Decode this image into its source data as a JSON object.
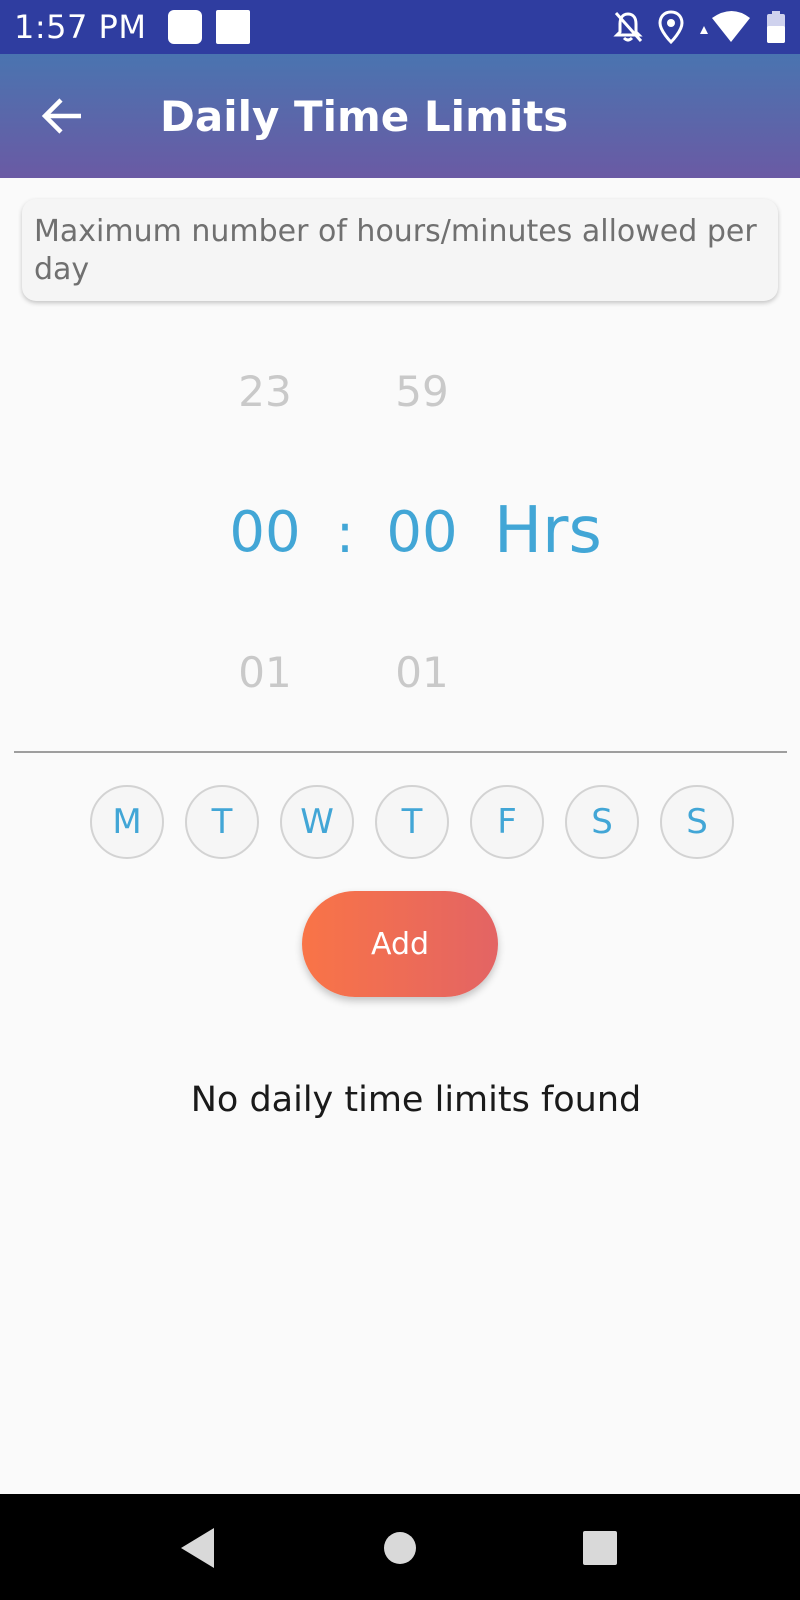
{
  "status_bar": {
    "time": "1:57 PM",
    "icons": [
      "app-notification-icon",
      "app-notification-icon",
      "notifications-off-icon",
      "location-icon",
      "wifi-icon",
      "battery-icon"
    ]
  },
  "app_bar": {
    "title": "Daily Time Limits",
    "back_icon": "arrow-left-icon"
  },
  "description": "Maximum number of hours/minutes allowed per day",
  "picker": {
    "hours_prev": "23",
    "hours_selected": "00",
    "hours_next": "01",
    "separator": ":",
    "minutes_prev": "59",
    "minutes_selected": "00",
    "minutes_next": "01",
    "unit": "Hrs"
  },
  "days": [
    {
      "label": "M"
    },
    {
      "label": "T"
    },
    {
      "label": "W"
    },
    {
      "label": "T"
    },
    {
      "label": "F"
    },
    {
      "label": "S"
    },
    {
      "label": "S"
    }
  ],
  "add_label": "Add",
  "empty_message": "No daily time limits found",
  "colors": {
    "status_bar": "#2f3da0",
    "app_bar_top": "#4a74b0",
    "app_bar_bottom": "#6a5aa4",
    "accent_blue": "#42a6d6",
    "add_gradient_start": "#f97447",
    "add_gradient_end": "#e36464"
  },
  "nav_bar": {
    "icons": [
      "back-triangle-icon",
      "home-circle-icon",
      "recents-square-icon"
    ]
  }
}
